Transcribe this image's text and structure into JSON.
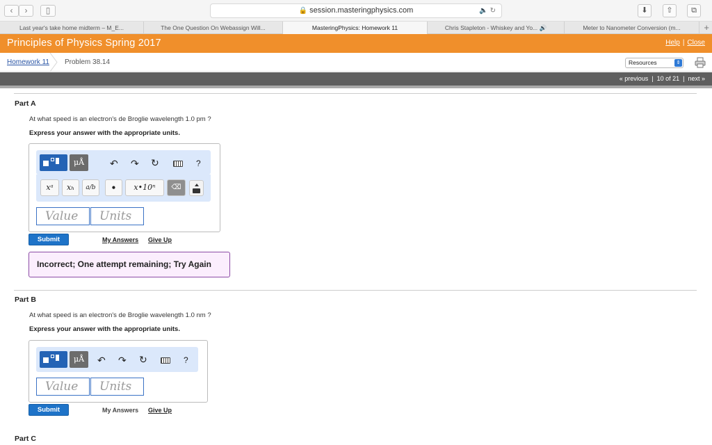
{
  "browser": {
    "url": "session.masteringphysics.com",
    "tabs": [
      {
        "label": "Last year's take home midterm – M_E..."
      },
      {
        "label": "The One Question On Webassign Will..."
      },
      {
        "label": "MasteringPhysics: Homework 11"
      },
      {
        "label": "Chris Stapleton - Whiskey and Yo..."
      },
      {
        "label": "Meter to Nanometer Conversion (m..."
      }
    ]
  },
  "header": {
    "course_title": "Principles of Physics Spring 2017",
    "help": "Help",
    "close": "Close"
  },
  "breadcrumb": {
    "homework": "Homework 11",
    "problem": "Problem 38.14",
    "resources": "Resources"
  },
  "pager": {
    "previous": "« previous",
    "position": "10 of 21",
    "next": "next »"
  },
  "toolbar_labels": {
    "mu": "μÅ",
    "help": "?",
    "x_pow": "xᵃ",
    "x_sub": "xₕ",
    "frac": "a/b",
    "dot": "•",
    "sci": "x•10ⁿ"
  },
  "parts": [
    {
      "title": "Part A",
      "question": "At what speed is an electron's de Broglie wavelength 1.0 pm ?",
      "instruction": "Express your answer with the appropriate units.",
      "value_placeholder": "Value",
      "units_placeholder": "Units",
      "submit": "Submit",
      "my_answers": "My Answers",
      "give_up": "Give Up",
      "feedback": "Incorrect; One attempt remaining; Try Again"
    },
    {
      "title": "Part B",
      "question": "At what speed is an electron's de Broglie wavelength 1.0 nm ?",
      "instruction": "Express your answer with the appropriate units.",
      "value_placeholder": "Value",
      "units_placeholder": "Units",
      "submit": "Submit",
      "my_answers": "My Answers",
      "give_up": "Give Up"
    },
    {
      "title": "Part C"
    }
  ]
}
